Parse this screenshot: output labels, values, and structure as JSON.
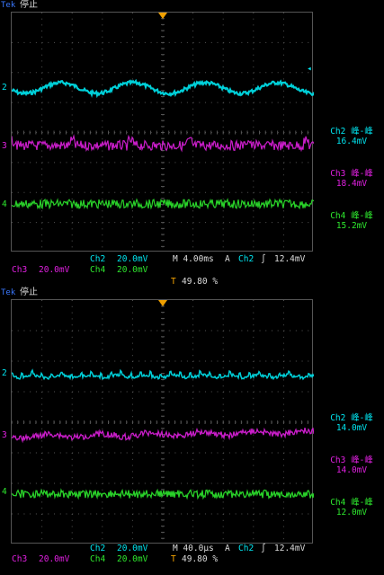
{
  "colors": {
    "ch2": "#00e5f0",
    "ch3": "#e020e0",
    "ch4": "#2ee82e",
    "trig": "#f0a000",
    "grid": "#555555"
  },
  "panels": [
    {
      "brand": "Tek",
      "state": "停止",
      "trigger_pct": "",
      "status": {
        "ch2": "20.0mV",
        "ch2_label": "Ch2",
        "ch3_label": "Ch3",
        "ch3": "20.0mV",
        "ch4_label": "Ch4",
        "ch4": "20.0mV",
        "time": "M 4.00ms",
        "a_label": "A",
        "trig_ch": "Ch2",
        "trig_level": "12.4mV"
      },
      "measurements": [
        {
          "label": "Ch2 峰-峰",
          "value": "16.4mV"
        },
        {
          "label": "Ch3 峰-峰",
          "value": "18.4mV"
        },
        {
          "label": "Ch4 峰-峰",
          "value": "15.2mV"
        }
      ],
      "markers": [
        "2",
        "3",
        "4"
      ]
    },
    {
      "brand": "Tek",
      "state": "停止",
      "trigger_pct": "49.80 %",
      "status": {
        "ch2": "20.0mV",
        "ch2_label": "Ch2",
        "ch3_label": "Ch3",
        "ch3": "20.0mV",
        "ch4_label": "Ch4",
        "ch4": "20.0mV",
        "time": "M 40.0µs",
        "a_label": "A",
        "trig_ch": "Ch2",
        "trig_level": "12.4mV"
      },
      "measurements": [
        {
          "label": "Ch2 峰-峰",
          "value": "14.0mV"
        },
        {
          "label": "Ch3 峰-峰",
          "value": "14.0mV"
        },
        {
          "label": "Ch4 峰-峰",
          "value": "12.0mV"
        }
      ],
      "markers": [
        "2",
        "3",
        "4"
      ]
    }
  ],
  "top_trigger_pct": "49.80 %"
}
